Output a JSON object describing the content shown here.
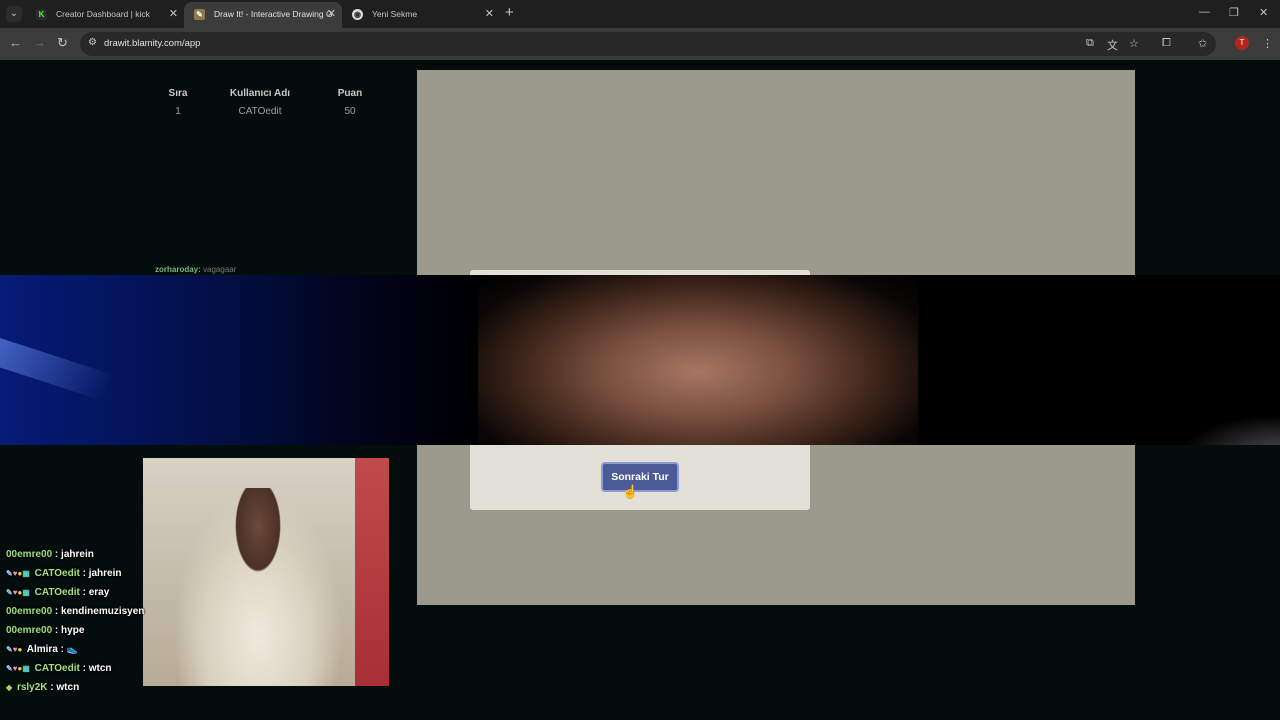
{
  "browser": {
    "tabs": [
      {
        "title": "Creator Dashboard | kick",
        "favicon": "kick-icon",
        "active": false
      },
      {
        "title": "Draw It! - Interactive Drawing G",
        "favicon": "drawit-icon",
        "active": true
      },
      {
        "title": "Yeni Sekme",
        "favicon": "chrome-icon",
        "active": false
      }
    ],
    "url": "drawit.blamity.com/app",
    "profile_initial": "T"
  },
  "scoreboard": {
    "headers": {
      "rank": "Sıra",
      "username": "Kullanıcı Adı",
      "score": "Puan"
    },
    "rows": [
      {
        "rank": "1",
        "username": "CATOedit",
        "score": "50"
      }
    ]
  },
  "overlay_chat_top": {
    "user": "zorharoday:",
    "text": "vagagaar"
  },
  "dialog": {
    "next_round_label": "Sonraki Tur"
  },
  "chat": [
    {
      "user": "00emre00",
      "sep": " : ",
      "text": "jahrein",
      "badges": false
    },
    {
      "user": "CATOedit",
      "sep": " : ",
      "text": "jahrein",
      "badges": true
    },
    {
      "user": "CATOedit",
      "sep": " : ",
      "text": "eray",
      "badges": true
    },
    {
      "user": "00emre00",
      "sep": " : ",
      "text": "kendinemuzisyen",
      "badges": false
    },
    {
      "user": "00emre00",
      "sep": " : ",
      "text": "hype",
      "badges": false
    },
    {
      "user": "Almira",
      "sep": " : ",
      "text": "",
      "badges": true
    },
    {
      "user": "CATOedit",
      "sep": " : ",
      "text": "wtcn",
      "badges": true
    },
    {
      "user": "rsly2K",
      "sep": " : ",
      "text": "wtcn",
      "badges": false
    }
  ]
}
